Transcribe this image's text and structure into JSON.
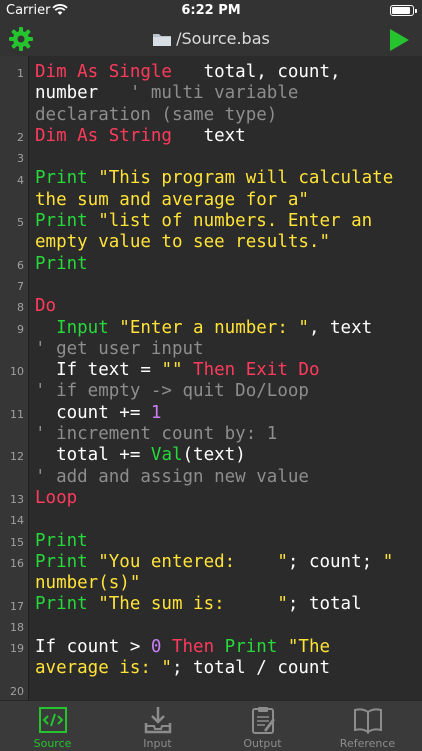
{
  "status_bar": {
    "carrier": "Carrier",
    "time": "6:22 PM",
    "battery_level": 0.9
  },
  "nav": {
    "title": "/Source.bas",
    "icons": {
      "settings": "gear-icon",
      "folder": "folder-icon",
      "run": "play-icon"
    }
  },
  "editor": {
    "line_numbers": [
      "1",
      "2",
      "3",
      "4",
      "5",
      "6",
      "7",
      "8",
      "9",
      "10",
      "11",
      "12",
      "13",
      "14",
      "15",
      "16",
      "17",
      "18",
      "19",
      "20"
    ],
    "rows": [
      [
        {
          "t": "Dim As Single",
          "c": "kw"
        },
        {
          "t": "   total, count,",
          "c": ""
        }
      ],
      [
        {
          "t": "number   ",
          "c": ""
        },
        {
          "t": "' multi variable",
          "c": "cm"
        }
      ],
      [
        {
          "t": "declaration (same type)",
          "c": "cm"
        }
      ],
      [
        {
          "t": "Dim As String",
          "c": "kw"
        },
        {
          "t": "   text",
          "c": ""
        }
      ],
      [],
      [
        {
          "t": "Print ",
          "c": "fn"
        },
        {
          "t": "\"This program will calculate",
          "c": "str"
        }
      ],
      [
        {
          "t": "the sum and average for a\"",
          "c": "str"
        }
      ],
      [
        {
          "t": "Print ",
          "c": "fn"
        },
        {
          "t": "\"list of numbers. Enter an",
          "c": "str"
        }
      ],
      [
        {
          "t": "empty value to see results.\"",
          "c": "str"
        }
      ],
      [
        {
          "t": "Print",
          "c": "fn"
        }
      ],
      [],
      [
        {
          "t": "Do",
          "c": "kw"
        }
      ],
      [
        {
          "t": "  ",
          "c": ""
        },
        {
          "t": "Input ",
          "c": "fn"
        },
        {
          "t": "\"Enter a number: \"",
          "c": "str"
        },
        {
          "t": ", text",
          "c": ""
        }
      ],
      [
        {
          "t": "' get user input",
          "c": "cm"
        }
      ],
      [
        {
          "t": "  If text = ",
          "c": ""
        },
        {
          "t": "\"\"",
          "c": "str"
        },
        {
          "t": " Then Exit Do",
          "c": "kw"
        }
      ],
      [
        {
          "t": "' if empty -> quit Do/Loop",
          "c": "cm"
        }
      ],
      [
        {
          "t": "  count += ",
          "c": ""
        },
        {
          "t": "1",
          "c": "num"
        }
      ],
      [
        {
          "t": "' increment count by: 1",
          "c": "cm"
        }
      ],
      [
        {
          "t": "  total += ",
          "c": ""
        },
        {
          "t": "Val",
          "c": "fn"
        },
        {
          "t": "(text)",
          "c": ""
        }
      ],
      [
        {
          "t": "' add and assign new value",
          "c": "cm"
        }
      ],
      [
        {
          "t": "Loop",
          "c": "kw"
        }
      ],
      [],
      [
        {
          "t": "Print",
          "c": "fn"
        }
      ],
      [
        {
          "t": "Print ",
          "c": "fn"
        },
        {
          "t": "\"You entered:    \"",
          "c": "str"
        },
        {
          "t": "; count; ",
          "c": ""
        },
        {
          "t": "\"",
          "c": "str"
        }
      ],
      [
        {
          "t": "number(s)\"",
          "c": "str"
        }
      ],
      [
        {
          "t": "Print ",
          "c": "fn"
        },
        {
          "t": "\"The sum is:     \"",
          "c": "str"
        },
        {
          "t": "; total",
          "c": ""
        }
      ],
      [],
      [
        {
          "t": "If count > ",
          "c": ""
        },
        {
          "t": "0",
          "c": "num"
        },
        {
          "t": " Then ",
          "c": "kw"
        },
        {
          "t": "Print ",
          "c": "fn"
        },
        {
          "t": "\"The",
          "c": "str"
        }
      ],
      [
        {
          "t": "average is: \"",
          "c": "str"
        },
        {
          "t": "; total / count",
          "c": ""
        }
      ],
      []
    ]
  },
  "tabs": [
    {
      "label": "Source",
      "icon": "code-icon",
      "active": true
    },
    {
      "label": "Input",
      "icon": "input-tray-icon",
      "active": false
    },
    {
      "label": "Output",
      "icon": "clipboard-icon",
      "active": false
    },
    {
      "label": "Reference",
      "icon": "book-icon",
      "active": false
    }
  ],
  "colors": {
    "keyword": "#ff3b5c",
    "function": "#26d83a",
    "string": "#ffe338",
    "comment": "#8d8d8d",
    "number": "#c67ef2",
    "active_tab": "#25c42f"
  }
}
